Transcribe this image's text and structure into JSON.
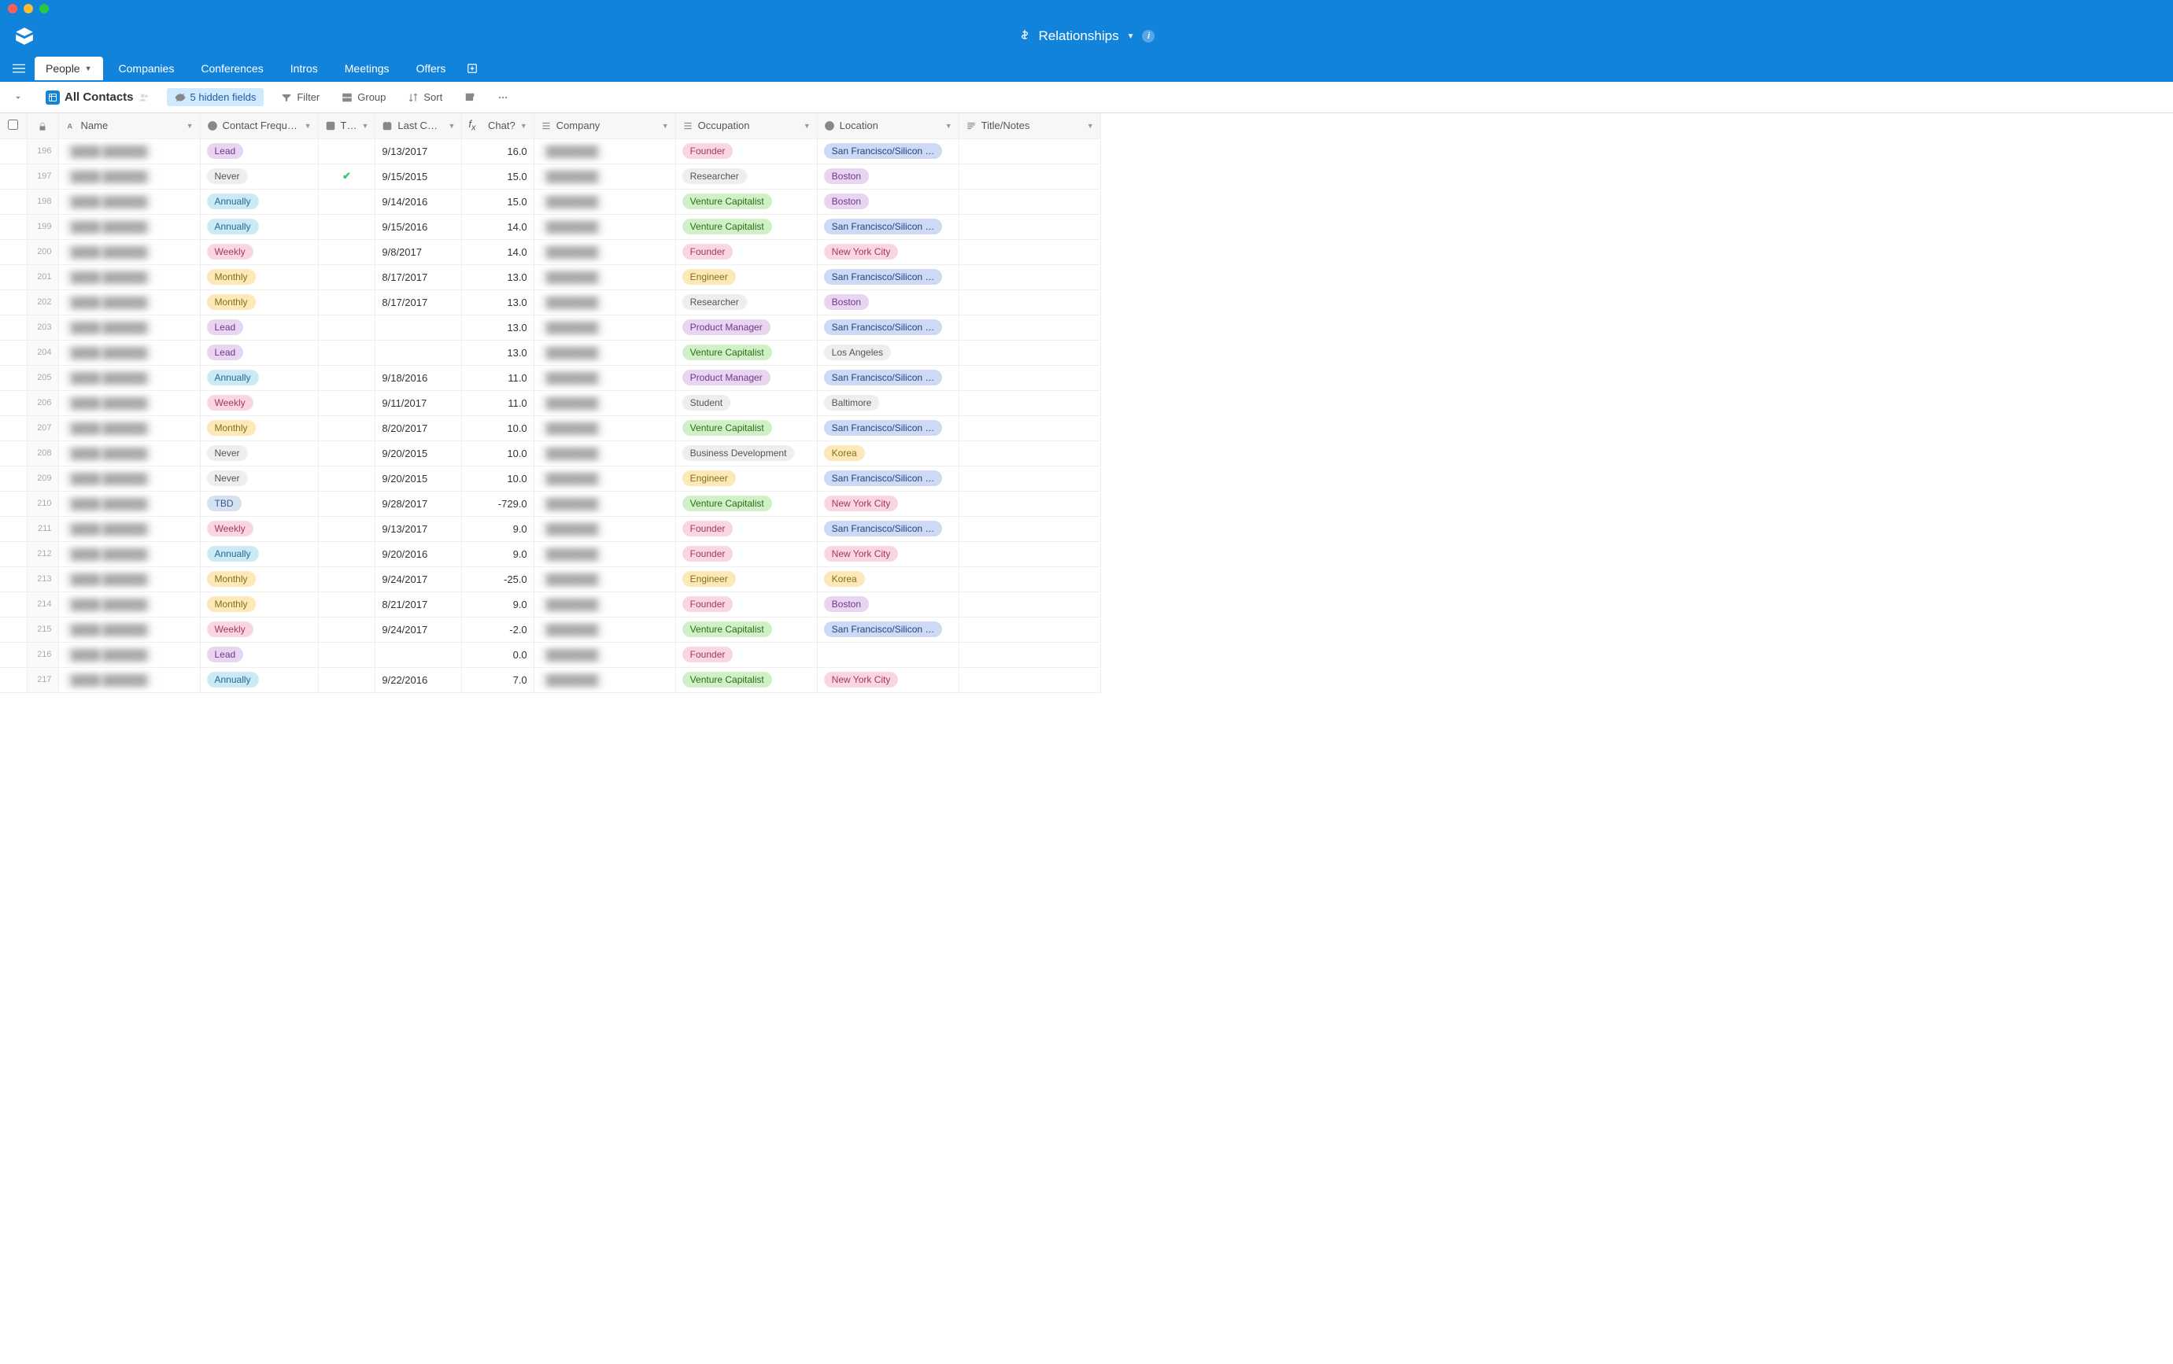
{
  "app": {
    "title": "Relationships"
  },
  "tabs": [
    {
      "label": "People",
      "active": true
    },
    {
      "label": "Companies"
    },
    {
      "label": "Conferences"
    },
    {
      "label": "Intros"
    },
    {
      "label": "Meetings"
    },
    {
      "label": "Offers"
    }
  ],
  "toolbar": {
    "view_name": "All Contacts",
    "hidden_fields": "5 hidden fields",
    "filter": "Filter",
    "group": "Group",
    "sort": "Sort"
  },
  "columns": {
    "name": "Name",
    "freq": "Contact Frequ…",
    "t": "T…",
    "last": "Last C…",
    "chat": "Chat?",
    "company": "Company",
    "occupation": "Occupation",
    "location": "Location",
    "title": "Title/Notes"
  },
  "pill_labels": {
    "lead": "Lead",
    "never": "Never",
    "annually": "Annually",
    "weekly": "Weekly",
    "monthly": "Monthly",
    "tbd": "TBD",
    "founder": "Founder",
    "researcher": "Researcher",
    "vc": "Venture Capitalist",
    "engineer": "Engineer",
    "pm": "Product Manager",
    "student": "Student",
    "bizdev": "Business Development",
    "sf": "San Francisco/Silicon …",
    "boston": "Boston",
    "nyc": "New York City",
    "la": "Los Angeles",
    "baltimore": "Baltimore",
    "korea": "Korea"
  },
  "rows": [
    {
      "num": "196",
      "freq": "lead",
      "t": "",
      "last": "9/13/2017",
      "chat": "16.0",
      "occ": "founder",
      "loc": "sf"
    },
    {
      "num": "197",
      "freq": "never",
      "t": "✓",
      "last": "9/15/2015",
      "chat": "15.0",
      "occ": "researcher",
      "loc": "boston"
    },
    {
      "num": "198",
      "freq": "annually",
      "t": "",
      "last": "9/14/2016",
      "chat": "15.0",
      "occ": "vc",
      "loc": "boston"
    },
    {
      "num": "199",
      "freq": "annually",
      "t": "",
      "last": "9/15/2016",
      "chat": "14.0",
      "occ": "vc",
      "loc": "sf"
    },
    {
      "num": "200",
      "freq": "weekly",
      "t": "",
      "last": "9/8/2017",
      "chat": "14.0",
      "occ": "founder",
      "loc": "nyc"
    },
    {
      "num": "201",
      "freq": "monthly",
      "t": "",
      "last": "8/17/2017",
      "chat": "13.0",
      "occ": "engineer",
      "loc": "sf"
    },
    {
      "num": "202",
      "freq": "monthly",
      "t": "",
      "last": "8/17/2017",
      "chat": "13.0",
      "occ": "researcher",
      "loc": "boston"
    },
    {
      "num": "203",
      "freq": "lead",
      "t": "",
      "last": "",
      "chat": "13.0",
      "occ": "pm",
      "loc": "sf"
    },
    {
      "num": "204",
      "freq": "lead",
      "t": "",
      "last": "",
      "chat": "13.0",
      "occ": "vc",
      "loc": "la"
    },
    {
      "num": "205",
      "freq": "annually",
      "t": "",
      "last": "9/18/2016",
      "chat": "11.0",
      "occ": "pm",
      "loc": "sf"
    },
    {
      "num": "206",
      "freq": "weekly",
      "t": "",
      "last": "9/11/2017",
      "chat": "11.0",
      "occ": "student",
      "loc": "baltimore"
    },
    {
      "num": "207",
      "freq": "monthly",
      "t": "",
      "last": "8/20/2017",
      "chat": "10.0",
      "occ": "vc",
      "loc": "sf"
    },
    {
      "num": "208",
      "freq": "never",
      "t": "",
      "last": "9/20/2015",
      "chat": "10.0",
      "occ": "bizdev",
      "loc": "korea"
    },
    {
      "num": "209",
      "freq": "never",
      "t": "",
      "last": "9/20/2015",
      "chat": "10.0",
      "occ": "engineer",
      "loc": "sf"
    },
    {
      "num": "210",
      "freq": "tbd",
      "t": "",
      "last": "9/28/2017",
      "chat": "-729.0",
      "occ": "vc",
      "loc": "nyc"
    },
    {
      "num": "211",
      "freq": "weekly",
      "t": "",
      "last": "9/13/2017",
      "chat": "9.0",
      "occ": "founder",
      "loc": "sf"
    },
    {
      "num": "212",
      "freq": "annually",
      "t": "",
      "last": "9/20/2016",
      "chat": "9.0",
      "occ": "founder",
      "loc": "nyc"
    },
    {
      "num": "213",
      "freq": "monthly",
      "t": "",
      "last": "9/24/2017",
      "chat": "-25.0",
      "occ": "engineer",
      "loc": "korea"
    },
    {
      "num": "214",
      "freq": "monthly",
      "t": "",
      "last": "8/21/2017",
      "chat": "9.0",
      "occ": "founder",
      "loc": "boston"
    },
    {
      "num": "215",
      "freq": "weekly",
      "t": "",
      "last": "9/24/2017",
      "chat": "-2.0",
      "occ": "vc",
      "loc": "sf"
    },
    {
      "num": "216",
      "freq": "lead",
      "t": "",
      "last": "",
      "chat": "0.0",
      "occ": "founder",
      "loc": ""
    },
    {
      "num": "217",
      "freq": "annually",
      "t": "",
      "last": "9/22/2016",
      "chat": "7.0",
      "occ": "vc",
      "loc": "nyc"
    }
  ]
}
